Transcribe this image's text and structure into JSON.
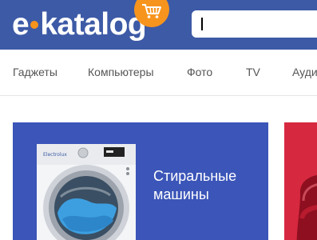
{
  "header": {
    "logo_left": "e",
    "logo_right": "katalog",
    "search": {
      "value": ""
    }
  },
  "nav": {
    "items": [
      {
        "label": "Гаджеты"
      },
      {
        "label": "Компьютеры"
      },
      {
        "label": "Фото"
      },
      {
        "label": "TV"
      },
      {
        "label": "Ауди"
      }
    ]
  },
  "cards": {
    "main": {
      "title": "Стиральные машины"
    }
  },
  "colors": {
    "header_bg": "#3d5aa6",
    "accent": "#f7941d",
    "card_blue": "#3b55b8",
    "card_red": "#d6283f"
  },
  "icons": [
    "cart-icon",
    "washing-machine-image",
    "red-appliance-image"
  ]
}
